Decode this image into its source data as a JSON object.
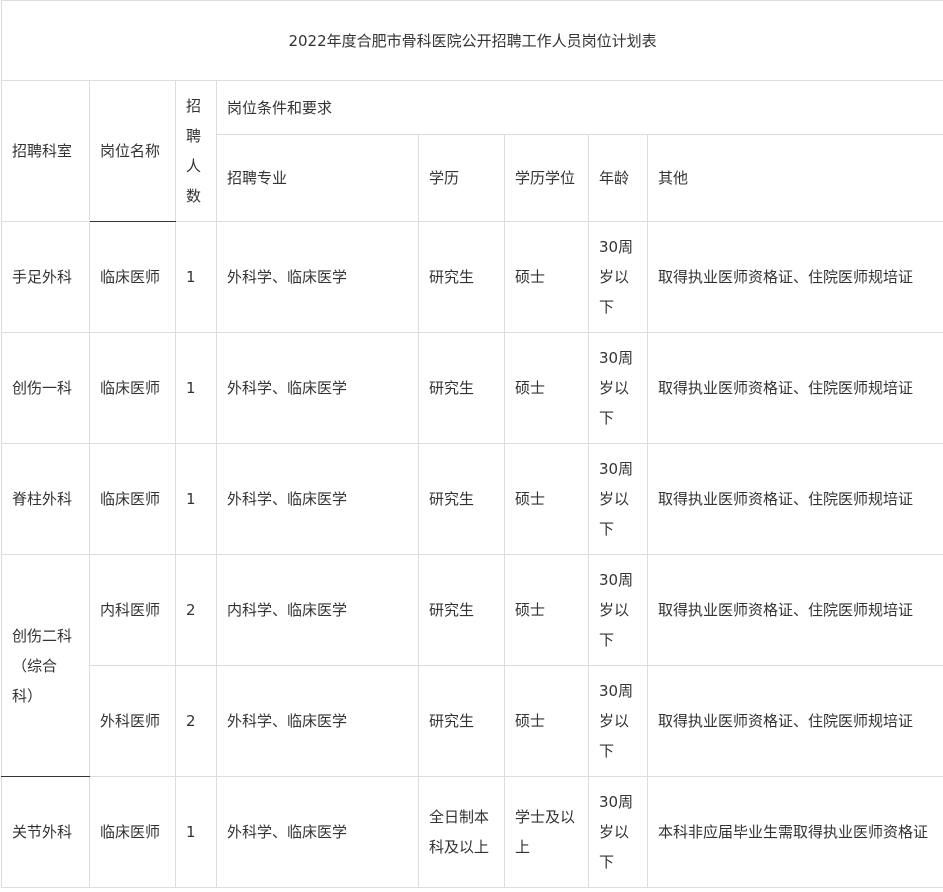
{
  "title": "2022年度合肥市骨科医院公开招聘工作人员岗位计划表",
  "headers": {
    "dept": "招聘科室",
    "position": "岗位名称",
    "count": "招聘人数",
    "requirements": "岗位条件和要求",
    "major": "招聘专业",
    "education": "学历",
    "degree": "学历学位",
    "age": "年龄",
    "other": "其他"
  },
  "rows": [
    {
      "dept": "手足外科",
      "position": "临床医师",
      "count": "1",
      "major": "外科学、临床医学",
      "education": "研究生",
      "degree": "硕士",
      "age": "30周岁以下",
      "other": "取得执业医师资格证、住院医师规培证"
    },
    {
      "dept": "创伤一科",
      "position": "临床医师",
      "count": "1",
      "major": "外科学、临床医学",
      "education": "研究生",
      "degree": "硕士",
      "age": "30周岁以下",
      "other": "取得执业医师资格证、住院医师规培证"
    },
    {
      "dept": "脊柱外科",
      "position": "临床医师",
      "count": "1",
      "major": "外科学、临床医学",
      "education": "研究生",
      "degree": "硕士",
      "age": "30周岁以下",
      "other": "取得执业医师资格证、住院医师规培证"
    },
    {
      "dept": "创伤二科（综合科）",
      "position": "内科医师",
      "count": "2",
      "major": "内科学、临床医学",
      "education": "研究生",
      "degree": "硕士",
      "age": "30周岁以下",
      "other": "取得执业医师资格证、住院医师规培证"
    },
    {
      "dept": "",
      "position": "外科医师",
      "count": "2",
      "major": "外科学、临床医学",
      "education": "研究生",
      "degree": "硕士",
      "age": "30周岁以下",
      "other": "取得执业医师资格证、住院医师规培证"
    },
    {
      "dept": "关节外科",
      "position": "临床医师",
      "count": "1",
      "major": "外科学、临床医学",
      "education": "全日制本科及以上",
      "degree": "学士及以上",
      "age": "30周岁以下",
      "other": "本科非应届毕业生需取得执业医师资格证"
    }
  ]
}
